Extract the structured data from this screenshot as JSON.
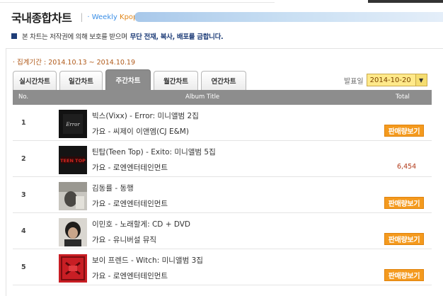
{
  "header": {
    "title": "국내종합차트",
    "separator": "|",
    "subtitle_prefix": "· Weekly ",
    "subtitle_suffix": "Kpop"
  },
  "notice": {
    "text": "본 차트는 저작권에 의해 보호를 받으며",
    "emphasis": "무단 전재, 복사, 배포를 금합니다."
  },
  "period": "· 집계기간 : 2014.10.13 ~ 2014.10.19",
  "tabs": [
    {
      "label": "실시간차트",
      "active": false
    },
    {
      "label": "일간차트",
      "active": false
    },
    {
      "label": "주간차트",
      "active": true
    },
    {
      "label": "월간차트",
      "active": false
    },
    {
      "label": "연간차트",
      "active": false
    }
  ],
  "release": {
    "label": "발표일",
    "date": "2014-10-20",
    "caret": "▼"
  },
  "table": {
    "headers": {
      "no": "No.",
      "title": "Album Title",
      "total": "Total"
    },
    "rows": [
      {
        "rank": "1",
        "song": "빅스(Vixx) - Error: 미니앨범 2집",
        "meta": "가요 - 씨제이 이앤엠(CJ E&M)",
        "total_button": "판매량보기",
        "total_value": ""
      },
      {
        "rank": "2",
        "song": "틴탑(Teen Top) - Exito: 미니앨범 5집",
        "meta": "가요 - 로엔엔터테인먼트",
        "total_button": "",
        "total_value": "6,454"
      },
      {
        "rank": "3",
        "song": "김동률 - 동행",
        "meta": "가요 - 로엔엔터테인먼트",
        "total_button": "판매량보기",
        "total_value": ""
      },
      {
        "rank": "4",
        "song": "이민호 - 노래할게: CD + DVD",
        "meta": "가요 - 유니버설 뮤직",
        "total_button": "판매량보기",
        "total_value": ""
      },
      {
        "rank": "5",
        "song": "보이 프렌드 - Witch: 미니앨범 3집",
        "meta": "가요 - 로엔엔터테인먼트",
        "total_button": "판매량보기",
        "total_value": ""
      }
    ]
  },
  "covers": {
    "error_text": "Error",
    "teentop_text": "TEEN TOP"
  },
  "colors": {
    "accent_orange": "#f49a1e",
    "notice_blue": "#1e3d78",
    "header_gray": "#8d8d8d",
    "date_yellow": "#ffe98a"
  }
}
